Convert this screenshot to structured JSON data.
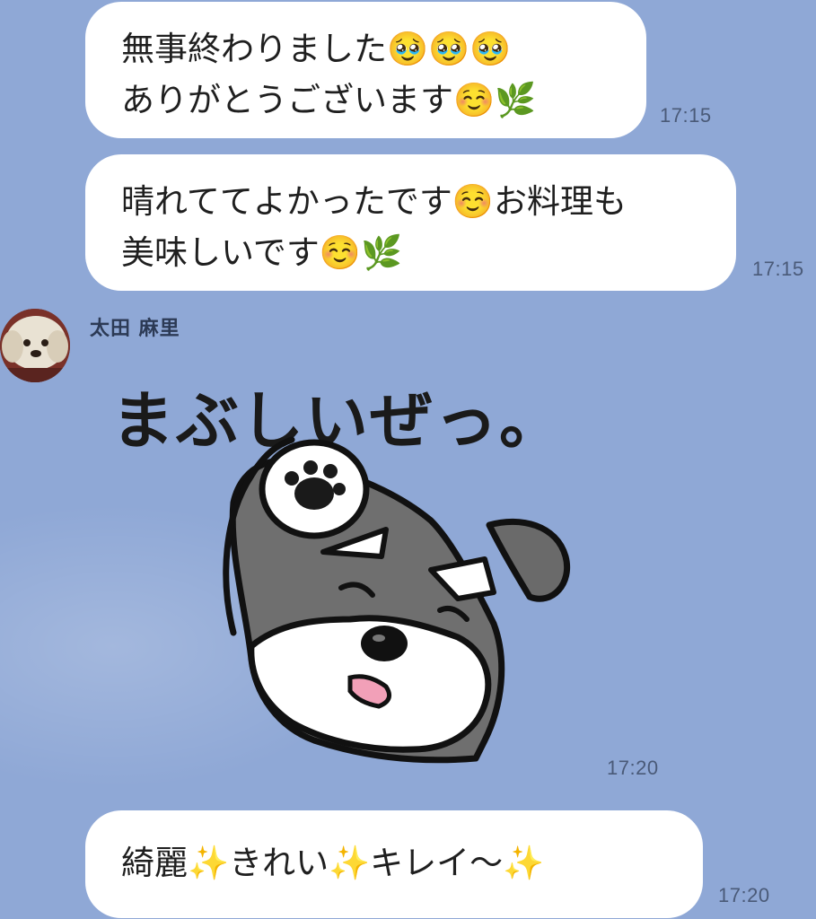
{
  "messages": [
    {
      "lines": [
        "無事終わりました🥹🥹🥹",
        "ありがとうございます☺️🌿"
      ],
      "time": "17:15"
    },
    {
      "lines": [
        "晴れててよかったです☺️お料理も",
        "美味しいです☺️🌿"
      ],
      "time": "17:15"
    },
    {
      "sender": "太田 麻里",
      "sticker_text": "まぶしいぜっ。",
      "time": "17:20"
    },
    {
      "lines": [
        "綺麗✨きれい✨キレイ〜✨"
      ],
      "time": "17:20"
    }
  ],
  "colors": {
    "background": "#8fa8d6",
    "bubble": "#ffffff",
    "timestamp": "#4a5a78"
  },
  "icons": [
    "pleading-face-emoji",
    "smiling-face-emoji",
    "herb-emoji",
    "sparkles-emoji",
    "dog-avatar",
    "schnauzer-sticker"
  ]
}
